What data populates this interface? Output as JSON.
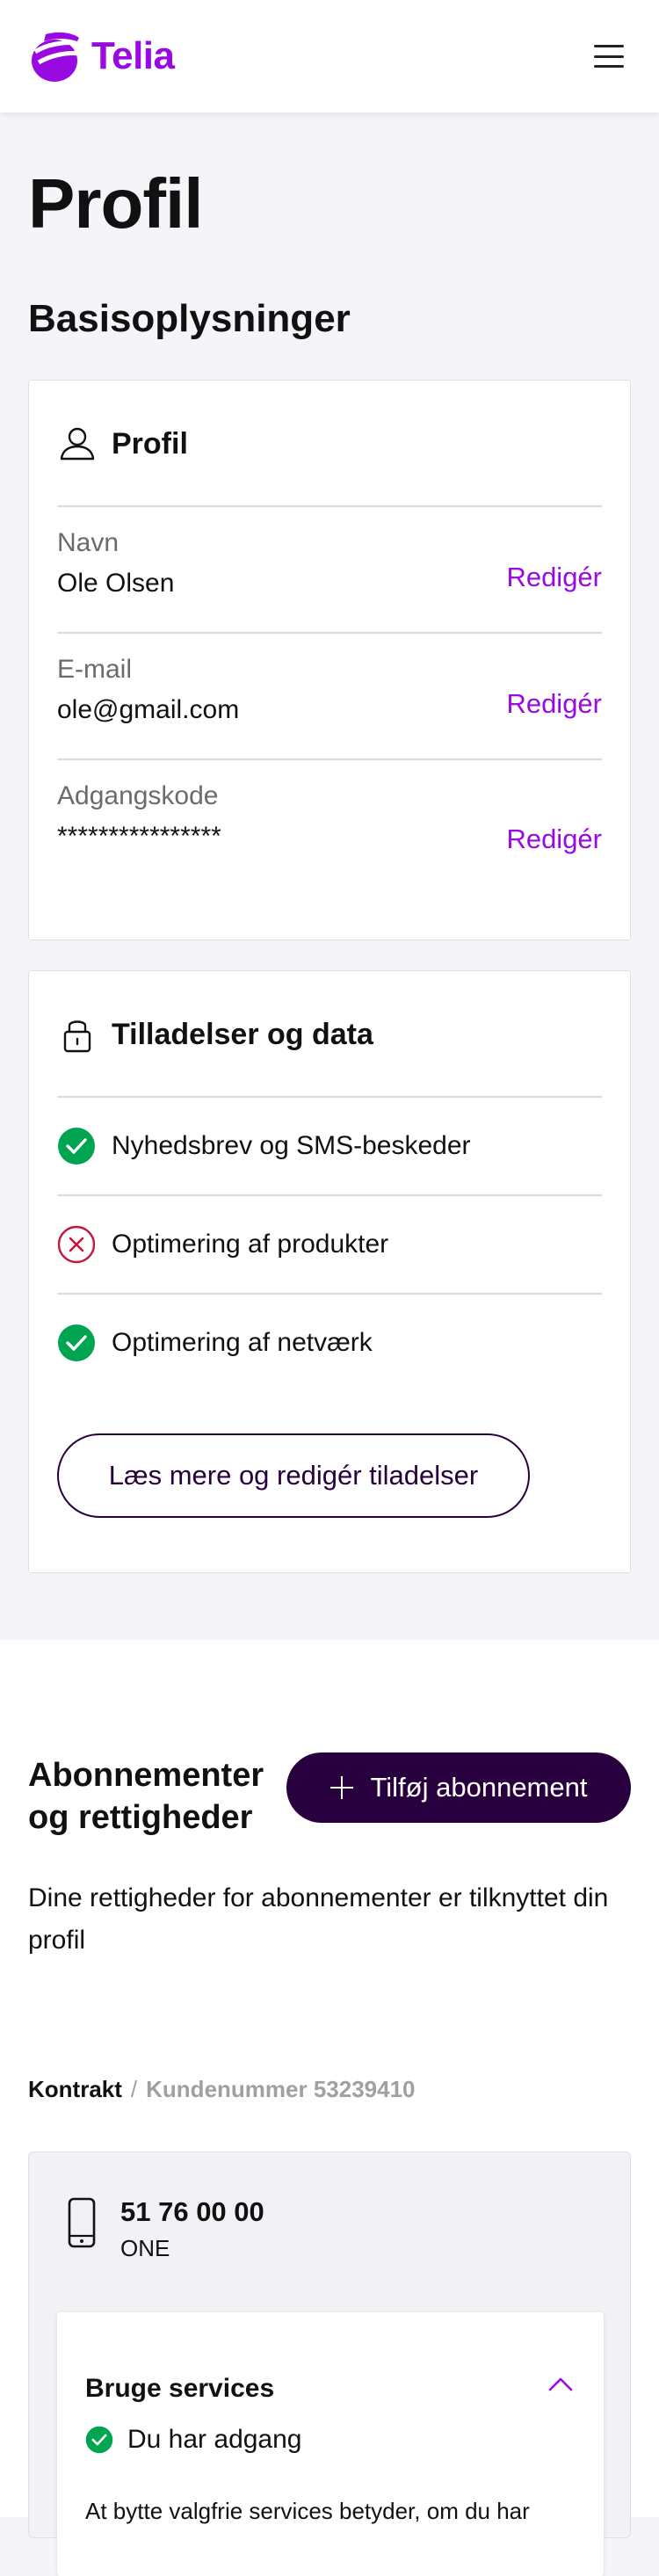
{
  "header": {
    "logo_text": "Telia",
    "logo_icon": "telia-pebble-logo",
    "menu_icon": "hamburger-menu-icon"
  },
  "page": {
    "title": "Profil",
    "section_title": "Basisoplysninger"
  },
  "profile_card": {
    "title": "Profil",
    "icon": "user-icon",
    "fields": [
      {
        "label": "Navn",
        "value": "Ole Olsen",
        "action": "Redigér"
      },
      {
        "label": "E-mail",
        "value": "ole@gmail.com",
        "action": "Redigér"
      },
      {
        "label": "Adgangskode",
        "value": "****************",
        "action": "Redigér"
      }
    ]
  },
  "permissions_card": {
    "title": "Tilladelser og data",
    "icon": "lock-icon",
    "items": [
      {
        "label": "Nyhedsbrev og SMS-beskeder",
        "status": "granted"
      },
      {
        "label": "Optimering af produkter",
        "status": "denied"
      },
      {
        "label": "Optimering af netværk",
        "status": "granted"
      }
    ],
    "button_label": "Læs mere og redigér tiladelser"
  },
  "subscriptions": {
    "title": "Abonnementer og rettigheder",
    "add_button": "Tilføj abonnement",
    "description": "Dine rettigheder for abonnementer er tilknyttet din profil",
    "breadcrumb": {
      "contract": "Kontrakt",
      "separator": "/",
      "customer_number": "Kundenummer 53239410"
    },
    "contract": {
      "phone_number": "51 76 00 00",
      "plan": "ONE",
      "services": {
        "title": "Bruge services",
        "access": "Du har adgang",
        "text": "At bytte valgfrie services betyder, om du har"
      }
    }
  },
  "colors": {
    "brand_purple": "#990ae3",
    "deep_purple": "#29003e",
    "success_green": "#00a552",
    "error_red": "#c4173d",
    "background": "#f4f4f9"
  }
}
